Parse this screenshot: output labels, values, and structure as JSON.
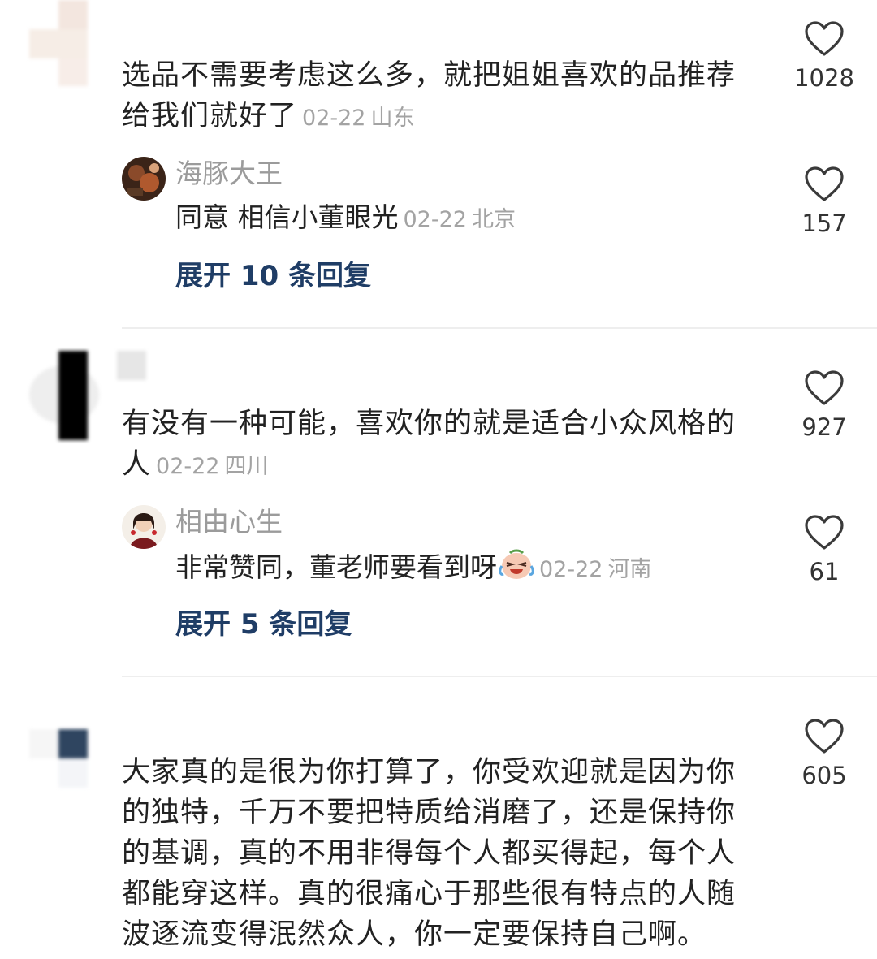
{
  "comments": [
    {
      "text_line1": "选品不需要考虑这么多，就把姐姐喜欢的品推荐",
      "text_line2": "给我们就好了",
      "date": "02-22",
      "location": "山东",
      "likes": "1028",
      "reply": {
        "username": "海豚大王",
        "text": "同意 相信小董眼光",
        "date": "02-22",
        "location": "北京",
        "likes": "157"
      },
      "expand_label": "展开 10 条回复"
    },
    {
      "text_line1": "有没有一种可能，喜欢你的就是适合小众风格的",
      "text_line2": "人",
      "date": "02-22",
      "location": "四川",
      "likes": "927",
      "reply": {
        "username": "相由心生",
        "text": "非常赞同，董老师要看到呀",
        "date": "02-22",
        "location": "河南",
        "likes": "61"
      },
      "expand_label": "展开 5 条回复"
    },
    {
      "lines": [
        "大家真的是很为你打算了，你受欢迎就是因为你",
        "的独特，千万不要把特质给消磨了，还是保持你",
        "的基调，真的不用非得每个人都买得起，每个人",
        "都能穿这样。真的很痛心于那些很有特点的人随",
        "波逐流变得泯然众人，你一定要保持自己啊。"
      ],
      "likes": "605"
    }
  ],
  "colors": {
    "expand_link": "#1f3d66",
    "meta_gray": "#a3a3a3",
    "username_gray": "#9b9b9b",
    "divider": "#eeeeee"
  },
  "icons": {
    "like": "heart-outline-icon",
    "emoji": "crying-laughing-emoji-icon"
  }
}
